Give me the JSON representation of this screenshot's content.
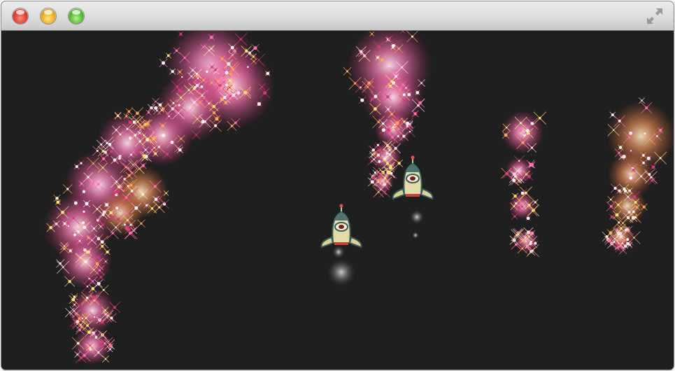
{
  "window": {
    "controls": [
      "close",
      "minimize",
      "maximize"
    ],
    "fullscreen_icon": "fullscreen-arrows-icon"
  },
  "game": {
    "background": "#1f1f1f",
    "sparkle_colors": [
      "#ff6fb0",
      "#ffa35c",
      "#ffd9e6",
      "#d43a7a",
      "#ffe27a"
    ],
    "rockets": [
      {
        "name": "rocket-ship-left",
        "icon": "rocket-icon"
      },
      {
        "name": "rocket-ship-right",
        "icon": "rocket-icon"
      }
    ]
  }
}
